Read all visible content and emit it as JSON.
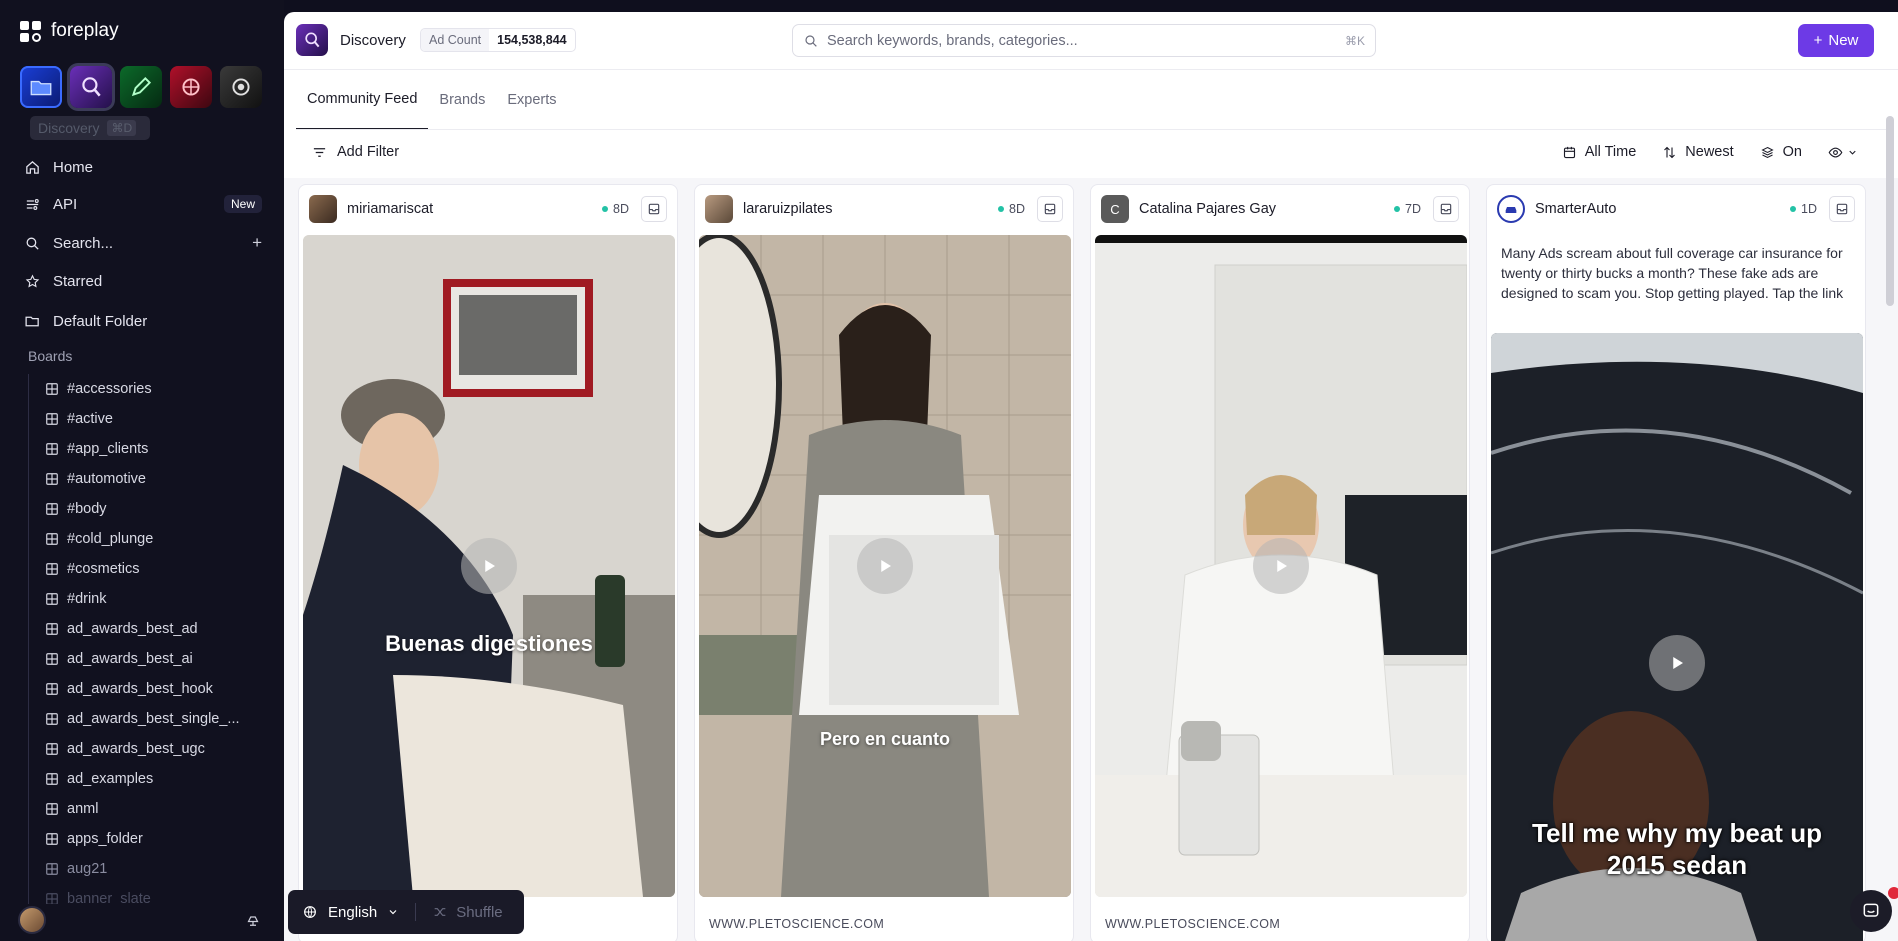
{
  "sidebar": {
    "brand": "foreplay",
    "tooltip": {
      "label": "Discovery",
      "shortcut": "⌘D"
    },
    "nav": [
      {
        "label": "Home",
        "icon": "home-icon"
      },
      {
        "label": "API",
        "icon": "api-icon",
        "badge": "New"
      },
      {
        "label": "Search...",
        "icon": "search-icon"
      },
      {
        "label": "Starred",
        "icon": "star-icon"
      },
      {
        "label": "Default Folder",
        "icon": "folder-icon"
      }
    ],
    "boards_label": "Boards",
    "boards": [
      "#accessories",
      "#active",
      "#app_clients",
      "#automotive",
      "#body",
      "#cold_plunge",
      "#cosmetics",
      "#drink",
      "ad_awards_best_ad",
      "ad_awards_best_ai",
      "ad_awards_best_hook",
      "ad_awards_best_single_...",
      "ad_awards_best_ugc",
      "ad_examples",
      "anml",
      "apps_folder",
      "aug21",
      "banner_slate"
    ]
  },
  "header": {
    "title": "Discovery",
    "ad_count_label": "Ad Count",
    "ad_count_value": "154,538,844",
    "search_placeholder": "Search keywords, brands, categories...",
    "search_shortcut": "⌘K",
    "new_button": "New"
  },
  "tabs": [
    {
      "label": "Community Feed",
      "active": true
    },
    {
      "label": "Brands",
      "active": false
    },
    {
      "label": "Experts",
      "active": false
    }
  ],
  "filters": {
    "add_filter": "Add Filter",
    "time": "All Time",
    "sort": "Newest",
    "toggle": "On"
  },
  "cards": [
    {
      "name": "miriamariscat",
      "age": "8D",
      "caption": "Buenas digestiones",
      "footer": ""
    },
    {
      "name": "lararuizpilates",
      "age": "8D",
      "caption": "Pero en cuanto",
      "footer": "WWW.PLETOSCIENCE.COM"
    },
    {
      "name": "Catalina Pajares Gay",
      "avatar_letter": "C",
      "age": "7D",
      "caption": "",
      "footer": "WWW.PLETOSCIENCE.COM"
    },
    {
      "name": "SmarterAuto",
      "age": "1D",
      "description": "Many Ads scream about full coverage car insurance for twenty or thirty bucks a month? These fake ads are designed to scam you. Stop getting played. Tap the link",
      "caption": "Tell me why my beat up 2015 sedan"
    }
  ],
  "bottom_bar": {
    "language": "English",
    "shuffle": "Shuffle"
  },
  "colors": {
    "accent": "#6d3ae6",
    "sidebar_bg": "#11111f",
    "status_green": "#23c2a6"
  }
}
